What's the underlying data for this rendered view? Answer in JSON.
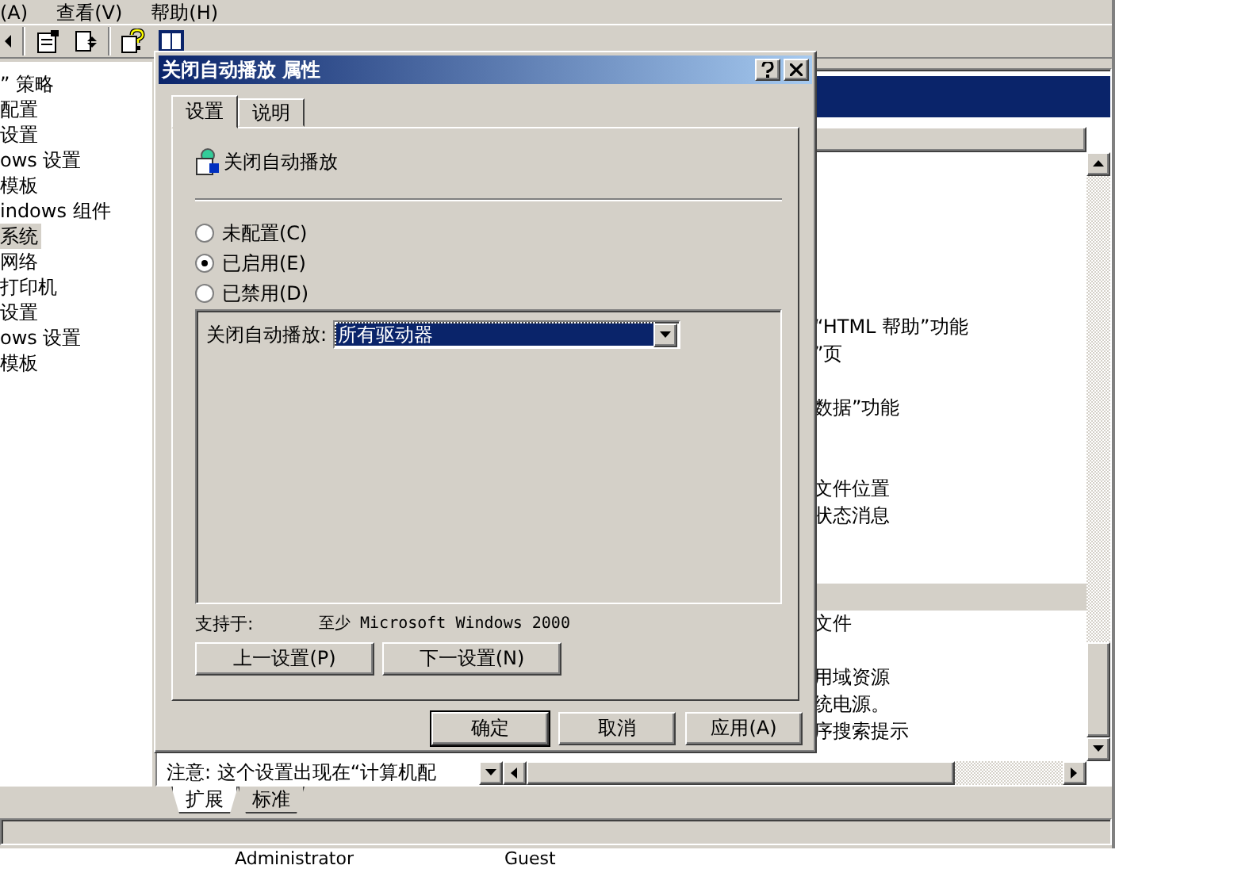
{
  "menu": [
    {
      "label": "(A)"
    },
    {
      "label": "查看(V)"
    },
    {
      "label": "帮助(H)"
    }
  ],
  "tree": {
    "items": [
      {
        "label": "” 策略",
        "selected": false
      },
      {
        "label": "配置",
        "selected": false
      },
      {
        "label": "设置",
        "selected": false
      },
      {
        "label": "ows 设置",
        "selected": false
      },
      {
        "label": "模板",
        "selected": false
      },
      {
        "label": "indows 组件",
        "selected": false
      },
      {
        "label": "系统",
        "selected": true
      },
      {
        "label": "网络",
        "selected": false
      },
      {
        "label": "打印机",
        "selected": false
      },
      {
        "label": "设置",
        "selected": false
      },
      {
        "label": "ows 设置",
        "selected": false
      },
      {
        "label": "模板",
        "selected": false
      }
    ]
  },
  "description": {
    "text": "注意: 这个设置出现在“计算机配"
  },
  "list": {
    "rows": [
      {
        "selected": false
      },
      {
        "selected": false
      },
      {
        "selected": false
      },
      {
        "selected": false
      },
      {
        "selected": false
      },
      {
        "selected": false
      },
      {
        "text": "“HTML 帮助”功能",
        "selected": false
      },
      {
        "text": "”页",
        "selected": false
      },
      {
        "selected": false
      },
      {
        "text": "数据”功能",
        "selected": false
      },
      {
        "selected": false
      },
      {
        "selected": false
      },
      {
        "text": "文件位置",
        "selected": false
      },
      {
        "text": "状态消息",
        "selected": false
      },
      {
        "selected": false
      },
      {
        "selected": false
      },
      {
        "selected": true
      },
      {
        "text": "文件",
        "selected": false
      },
      {
        "selected": false
      },
      {
        "text": "用域资源",
        "selected": false
      },
      {
        "text": "统电源。",
        "selected": false
      },
      {
        "text": "序搜索提示",
        "selected": false
      }
    ]
  },
  "view_tabs": [
    {
      "label": "扩展",
      "selected": true
    },
    {
      "label": "标准",
      "selected": false
    }
  ],
  "users": [
    "Administrator",
    "Guest"
  ],
  "dialog": {
    "title": "关闭自动播放 属性",
    "tabs": [
      {
        "label": "设置",
        "selected": true
      },
      {
        "label": "说明",
        "selected": false
      }
    ],
    "policy_name": "关闭自动播放",
    "options": [
      {
        "label": "未配置(C)",
        "selected": false
      },
      {
        "label": "已启用(E)",
        "selected": true
      },
      {
        "label": "已禁用(D)",
        "selected": false
      }
    ],
    "setting": {
      "label": "关闭自动播放:",
      "value": "所有驱动器"
    },
    "supported": {
      "label": "支持于:",
      "value": "至少 Microsoft Windows 2000"
    },
    "nav_buttons": [
      "上一设置(P)",
      "下一设置(N)"
    ],
    "buttons": [
      {
        "label": "确定",
        "default": true
      },
      {
        "label": "取消",
        "default": false
      },
      {
        "label": "应用(A)",
        "default": false
      }
    ]
  }
}
